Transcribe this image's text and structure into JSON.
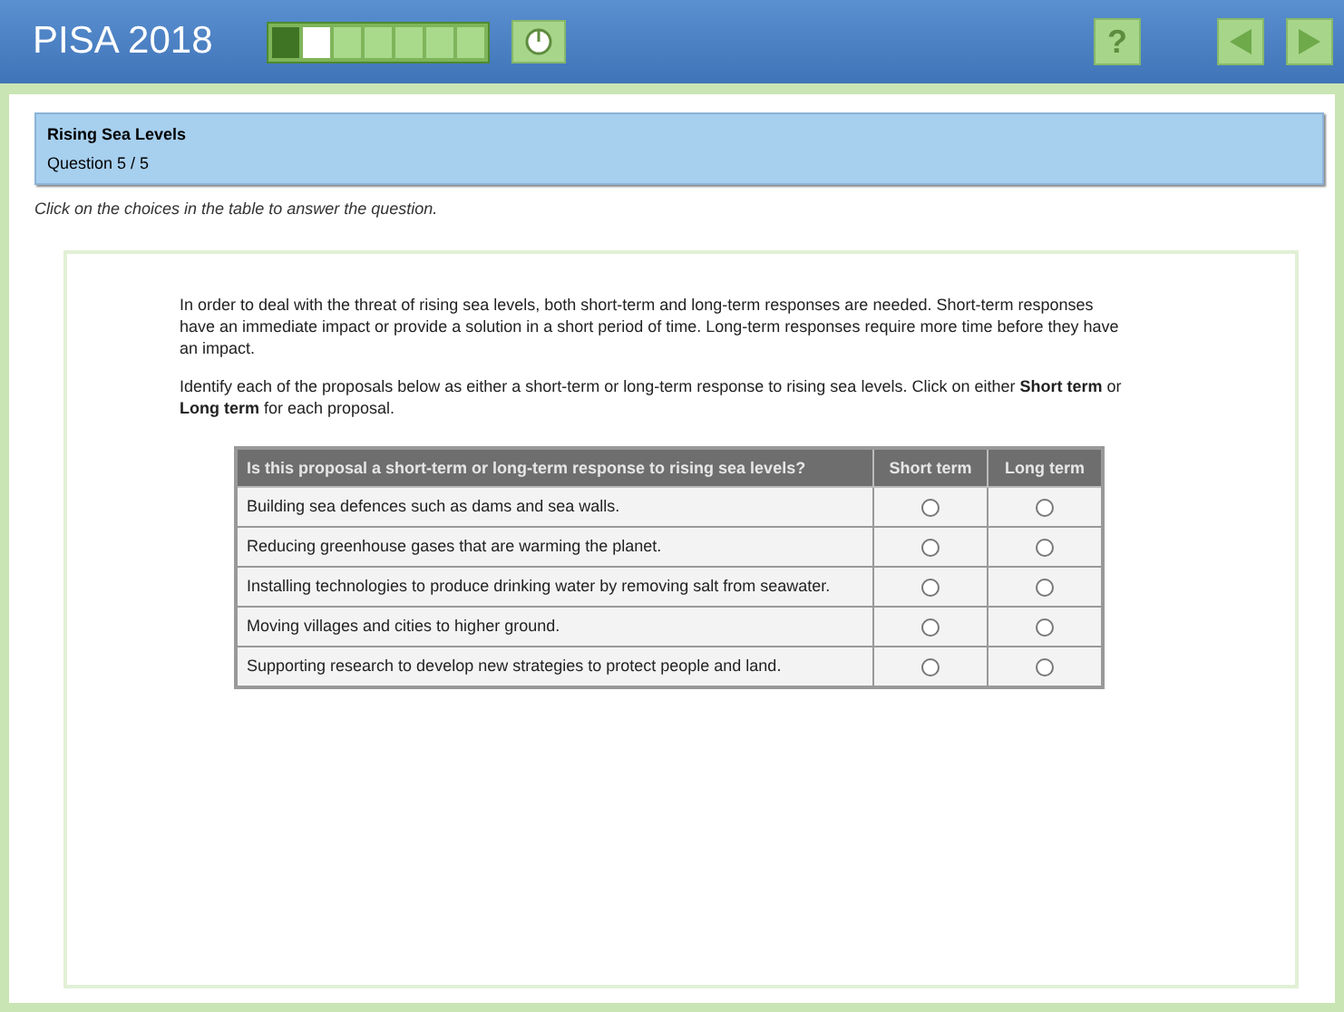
{
  "header": {
    "title": "PISA 2018",
    "progress": [
      {
        "kind": "done"
      },
      {
        "kind": "current"
      },
      {
        "kind": "todo"
      },
      {
        "kind": "todo"
      },
      {
        "kind": "todo"
      },
      {
        "kind": "todo"
      },
      {
        "kind": "todo"
      }
    ],
    "help": "?"
  },
  "unit": {
    "title": "Rising Sea Levels",
    "question": "Question 5 / 5"
  },
  "instruction": "Click on the choices in the table to answer the question.",
  "paragraphs": [
    "In order to deal with the threat of rising sea levels, both short-term and long-term responses are needed. Short-term responses have an immediate impact or provide a solution in a short period of time. Long-term responses require more time before they have an impact.",
    "Identify each of the proposals below as either a short-term or long-term response to rising sea levels. Click on either **Short term** or **Long term** for each proposal."
  ],
  "table": {
    "columns": [
      "Is this proposal a short-term or long-term response to rising sea levels?",
      "Short term",
      "Long term"
    ],
    "rows": [
      {
        "text": "Building sea defences such as dams and sea walls.",
        "short_selected": false,
        "long_selected": false
      },
      {
        "text": "Reducing greenhouse gases that are warming the planet.",
        "short_selected": false,
        "long_selected": false
      },
      {
        "text": "Installing technologies to produce drinking water by removing salt from seawater.",
        "short_selected": false,
        "long_selected": false
      },
      {
        "text": "Moving villages and cities to higher ground.",
        "short_selected": false,
        "long_selected": false
      },
      {
        "text": "Supporting research to develop new strategies to protect people and land.",
        "short_selected": false,
        "long_selected": false
      }
    ]
  }
}
